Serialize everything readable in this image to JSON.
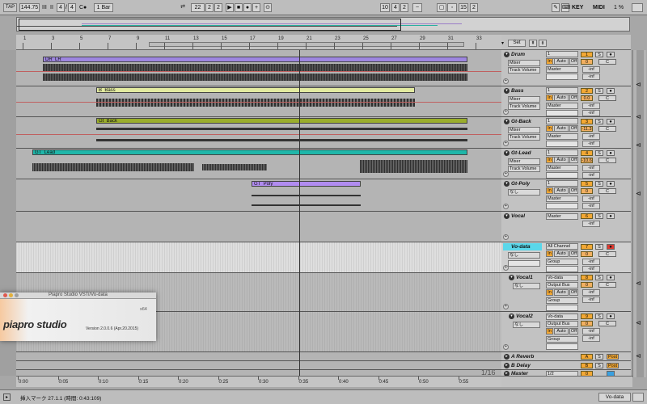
{
  "topbar": {
    "tap": "TAP",
    "tempo": "144.75",
    "iii": "III",
    "ii": "II",
    "sig_num": "4",
    "sig_den": "4",
    "co": "C●",
    "quantize": "1 Bar",
    "position": [
      "22",
      "2",
      "2"
    ],
    "loop_start": [
      "10",
      "4",
      "2"
    ],
    "loop_len": [
      "15",
      "2"
    ],
    "key": "KEY",
    "midi": "MIDI",
    "cpu": "1 %"
  },
  "ruler": {
    "bars": [
      "1",
      "3",
      "5",
      "7",
      "9",
      "11",
      "13",
      "15",
      "17",
      "19",
      "21",
      "23",
      "25",
      "27",
      "29",
      "31",
      "33"
    ]
  },
  "bottom_ruler": {
    "times": [
      "0:00",
      "0:05",
      "0:10",
      "0:15",
      "0:20",
      "0:25",
      "0:30",
      "0:35",
      "0:40",
      "0:45",
      "0:50",
      "0:55"
    ],
    "zoom": "1/16"
  },
  "mixer_header": {
    "set": "Set"
  },
  "clips": {
    "drum": "DR_LR",
    "bass": "B_Bass",
    "gtback": "Gt_Back",
    "gtlead": "GT_Lead",
    "gtpoly": "GT_Poly"
  },
  "tracks": [
    {
      "name": "Drum",
      "in1": "1",
      "in2": "Mixer",
      "in3": "Track Volume",
      "out": "Master",
      "num": "1",
      "vol": "0",
      "pan": "C",
      "peak": "-inf",
      "peak2": "-inf",
      "color": "#f3a834"
    },
    {
      "name": "Bass",
      "in1": "1",
      "in2": "Mixer",
      "in3": "Track Volume",
      "out": "Master",
      "num": "2",
      "vol": "0.0",
      "pan": "C",
      "peak": "-inf",
      "peak2": "-inf",
      "color": "#f3a834"
    },
    {
      "name": "Gt-Back",
      "in1": "1",
      "in2": "Mixer",
      "in3": "Track Volume",
      "out": "Master",
      "num": "3",
      "vol": "-11.3",
      "pan": "C",
      "peak": "-inf",
      "peak2": "-inf",
      "color": "#f3a834"
    },
    {
      "name": "Gt-Lead",
      "in1": "1",
      "in2": "Mixer",
      "in3": "Track Volume",
      "out": "Master",
      "num": "4",
      "vol": "-10.6",
      "pan": "C",
      "peak": "-inf",
      "peak2": "-inf",
      "color": "#f3a834"
    },
    {
      "name": "Gt-Poly",
      "in1": "1",
      "in2": "なし",
      "in3": "",
      "out": "Master",
      "num": "5",
      "vol": "0",
      "pan": "C",
      "peak": "-inf",
      "peak2": "-inf",
      "color": "#f3a834"
    },
    {
      "name": "Vocal",
      "in1": "",
      "in2": "なし",
      "in3": "",
      "out": "Master",
      "num": "6",
      "vol": "",
      "pan": "",
      "peak": "-inf",
      "peak2": "",
      "color": "#f3a834"
    },
    {
      "name": "Vo-data",
      "in1": "All Channel",
      "in2": "なし",
      "in3": "",
      "out": "Group",
      "num": "7",
      "vol": "0",
      "pan": "C",
      "peak": "-inf",
      "peak2": "-inf",
      "color": "#f3a834"
    },
    {
      "name": "Vocal1",
      "in1": "Vo-data",
      "in2": "なし",
      "in3": "Output Bus",
      "out": "Group",
      "num": "8",
      "vol": "0",
      "pan": "C",
      "peak": "-inf",
      "peak2": "-inf",
      "color": "#f3a834"
    },
    {
      "name": "Vocal2",
      "in1": "Vo-data",
      "in2": "なし",
      "in3": "Output Bus",
      "out": "Group",
      "num": "9",
      "vol": "0",
      "pan": "C",
      "peak": "-inf",
      "peak2": "-inf",
      "color": "#f3a834"
    }
  ],
  "monitor": {
    "in": "In",
    "auto": "Auto",
    "off": "Off"
  },
  "returns": [
    {
      "name": "A Reverb",
      "letter": "A",
      "post": "Post"
    },
    {
      "name": "B Delay",
      "letter": "B",
      "post": "Post"
    },
    {
      "name": "Master",
      "sel": "1/2",
      "num": "0"
    }
  ],
  "splash": {
    "title": "Piapro Studio VSTi/Vo-data",
    "logo": "piapro studio",
    "version": "Version 2.0.0.6 (Apr.20.2015)",
    "x64": "x64"
  },
  "status": {
    "text": "挿入マーク 27.1.1 (時間: 0:43:109)",
    "right": "Vo-data"
  }
}
